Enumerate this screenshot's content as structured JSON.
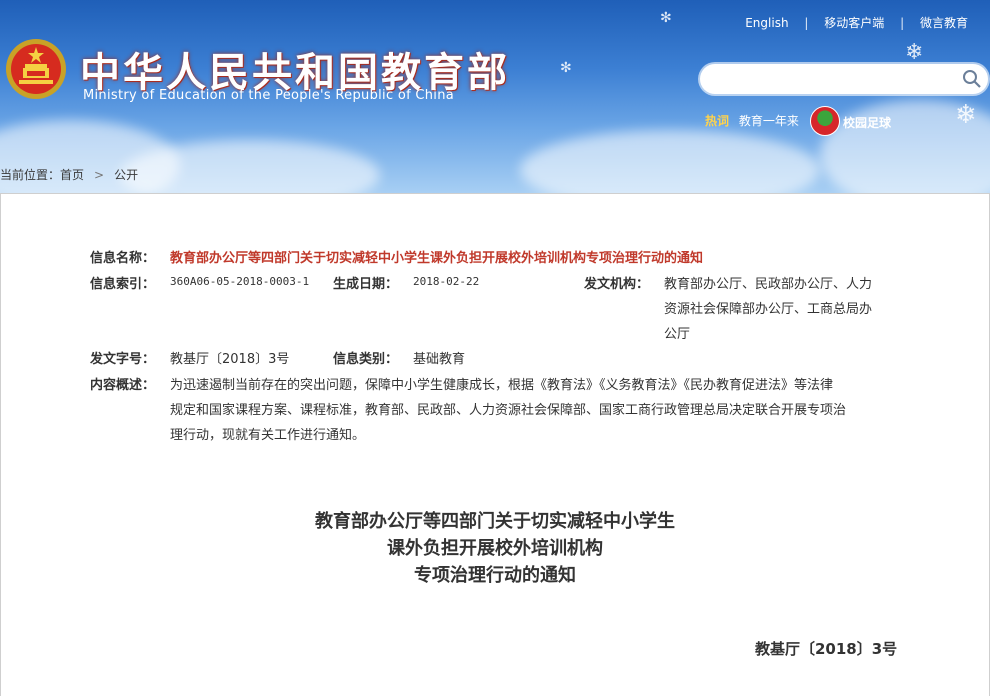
{
  "header": {
    "title_cn": "中华人民共和国教育部",
    "title_en": "Ministry of Education of the People's Republic of China",
    "links": [
      "English",
      "移动客户端",
      "微言教育"
    ],
    "hot_label": "热词",
    "hot_items": [
      "教育一年来"
    ],
    "feature_link": "校园足球"
  },
  "breadcrumb": {
    "prefix": "当前位置：",
    "items": [
      "首页",
      "公开"
    ]
  },
  "info": {
    "title_label": "信息名称：",
    "title_value": "教育部办公厅等四部门关于切实减轻中小学生课外负担开展校外培训机构专项治理行动的通知",
    "index_label": "信息索引：",
    "index_value": "360A06-05-2018-0003-1",
    "date_label": "生成日期：",
    "date_value": "2018-02-22",
    "issuer_label": "发文机构：",
    "issuer_lines": [
      "教育部办公厅、民政部办公厅、人力",
      "资源社会保障部办公厅、工商总局办",
      "公厅"
    ],
    "docno_label": "发文字号：",
    "docno_value": "教基厅〔2018〕3号",
    "category_label": "信息类别：",
    "category_value": "基础教育",
    "summary_label": "内容概述：",
    "summary_lines": [
      "为迅速遏制当前存在的突出问题，保障中小学生健康成长，根据《教育法》《义务教育法》《民办教育促进法》等法律",
      "规定和国家课程方案、课程标准，教育部、民政部、人力资源社会保障部、国家工商行政管理总局决定联合开展专项治",
      "理行动，现就有关工作进行通知。"
    ]
  },
  "document": {
    "heading_lines": [
      "教育部办公厅等四部门关于切实减轻中小学生",
      "课外负担开展校外培训机构",
      "专项治理行动的通知"
    ],
    "number": "教基厅〔2018〕3号"
  },
  "colors": {
    "header_top": "#1f5fb8",
    "header_bottom": "#a9d0f4",
    "title_red": "#c0392b",
    "hot_yellow": "#ffd34d"
  }
}
